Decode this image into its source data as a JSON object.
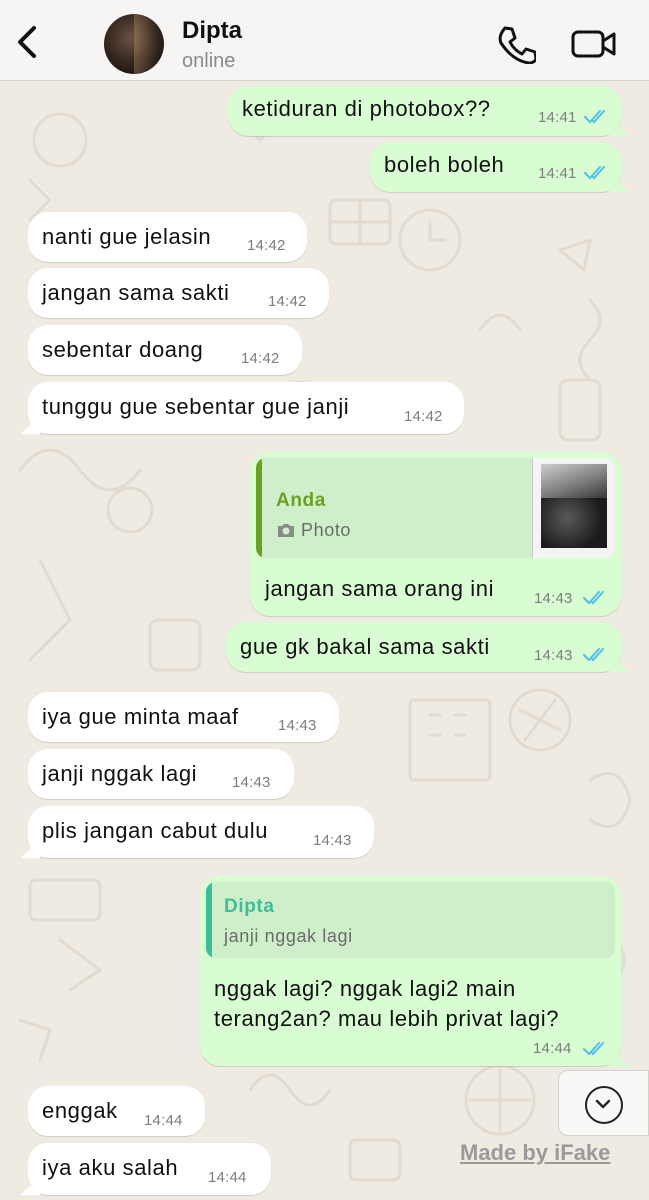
{
  "header": {
    "contact_name": "Dipta",
    "status": "online",
    "icons": [
      "back-chevron-icon",
      "phone-icon",
      "video-camera-icon"
    ]
  },
  "colors": {
    "incoming_bubble": "#ffffff",
    "outgoing_bubble": "#d9fdd3",
    "read_tick": "#53bdeb",
    "quote_anda": "#6aa125",
    "quote_dipta": "#3bbf9a"
  },
  "messages": [
    {
      "dir": "out",
      "text": "ketiduran di photobox??",
      "time": "14:41",
      "status": "read"
    },
    {
      "dir": "out",
      "text": "boleh boleh",
      "time": "14:41",
      "status": "read"
    },
    {
      "dir": "in",
      "text": "nanti gue jelasin",
      "time": "14:42"
    },
    {
      "dir": "in",
      "text": "jangan sama sakti",
      "time": "14:42"
    },
    {
      "dir": "in",
      "text": "sebentar doang",
      "time": "14:42"
    },
    {
      "dir": "in",
      "text": "tunggu gue sebentar gue janji",
      "time": "14:42"
    },
    {
      "dir": "out",
      "reply_to": {
        "author": "Anda",
        "text": "Photo",
        "icon": "camera-icon"
      },
      "text": "jangan sama orang ini",
      "time": "14:43",
      "status": "read"
    },
    {
      "dir": "out",
      "text": "gue gk bakal sama sakti",
      "time": "14:43",
      "status": "read"
    },
    {
      "dir": "in",
      "text": "iya gue minta maaf",
      "time": "14:43"
    },
    {
      "dir": "in",
      "text": "janji nggak lagi",
      "time": "14:43"
    },
    {
      "dir": "in",
      "text": "plis jangan cabut dulu",
      "time": "14:43"
    },
    {
      "dir": "out",
      "reply_to": {
        "author": "Dipta",
        "text": "janji nggak lagi"
      },
      "text_lines": [
        "nggak lagi? nggak lagi2 main",
        "terang2an? mau lebih privat lagi?"
      ],
      "time": "14:44",
      "status": "read"
    },
    {
      "dir": "in",
      "text": "enggak",
      "time": "14:44"
    },
    {
      "dir": "in",
      "text": "iya aku salah",
      "time": "14:44"
    }
  ],
  "scroll_button": {
    "icon": "chevron-down-icon"
  },
  "watermark": "Made by iFake"
}
